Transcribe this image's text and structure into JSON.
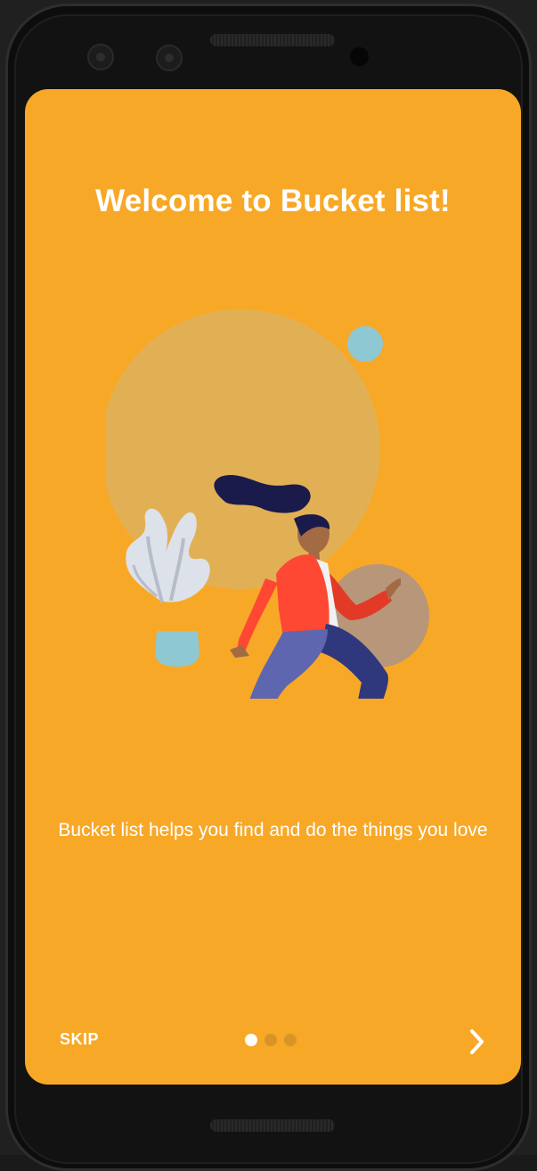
{
  "onboarding": {
    "title": "Welcome to Bucket list!",
    "description": "Bucket list helps you find and do the things you love",
    "skip_label": "SKIP",
    "page_indicator": {
      "total": 3,
      "current": 1
    },
    "next_icon": "chevron-right-icon"
  },
  "colors": {
    "background": "#f8a827",
    "text": "#ffffff",
    "dot_active": "#ffffff",
    "dot_inactive": "#d99427"
  }
}
